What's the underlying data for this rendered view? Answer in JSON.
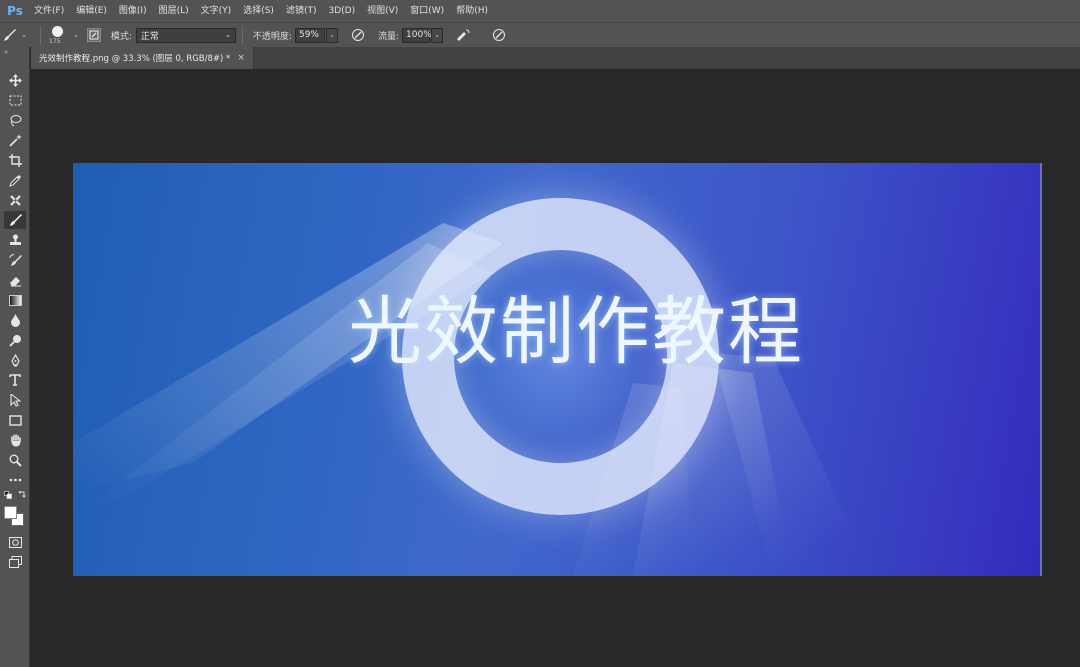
{
  "app": {
    "logo": "Ps",
    "menu": [
      "文件(F)",
      "编辑(E)",
      "图像(I)",
      "图层(L)",
      "文字(Y)",
      "选择(S)",
      "滤镜(T)",
      "3D(D)",
      "视图(V)",
      "窗口(W)",
      "帮助(H)"
    ]
  },
  "options": {
    "brush_size": "175",
    "mode_label": "模式:",
    "mode_value": "正常",
    "opacity_label": "不透明度:",
    "opacity_value": "59%",
    "flow_label": "流量:",
    "flow_value": "100%"
  },
  "document": {
    "tab_title": "光效制作教程.png @ 33.3% (图层 0, RGB/8#) *",
    "close_glyph": "×",
    "artwork_text": "光效制作教程"
  },
  "toolbar": {
    "tools": [
      "move-icon",
      "marquee-icon",
      "lasso-icon",
      "magic-wand-icon",
      "crop-icon",
      "eyedropper-icon",
      "healing-icon",
      "brush-icon",
      "stamp-icon",
      "history-brush-icon",
      "eraser-icon",
      "gradient-icon",
      "blur-icon",
      "dodge-icon",
      "pen-icon",
      "type-icon",
      "path-select-icon",
      "rectangle-icon",
      "hand-icon",
      "zoom-icon",
      "more-icon"
    ],
    "active_tool": "brush-icon"
  },
  "colors": {
    "ui_dark": "#535353",
    "canvas_bg": "#282828",
    "art_left": "#1f5db3",
    "art_right": "#342bbd",
    "foreground": "#ffffff",
    "background": "#ffffff"
  }
}
